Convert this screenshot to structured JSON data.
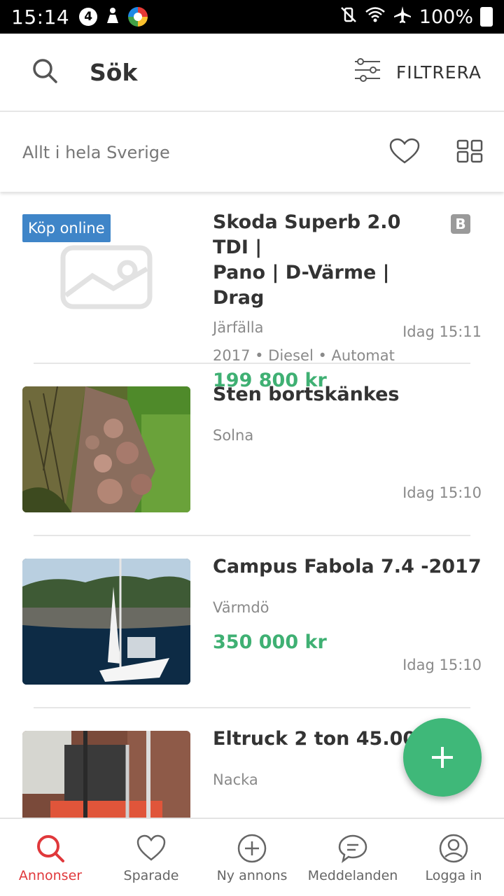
{
  "status_bar": {
    "time": "15:14",
    "battery": "100%",
    "badge_number": "4"
  },
  "header": {
    "title": "Sök",
    "filter_label": "FILTRERA"
  },
  "subbar": {
    "location": "Allt i hela Sverige"
  },
  "listings": [
    {
      "badge": "Köp online",
      "title_line1": "Skoda Superb 2.0 TDI |",
      "title_line2": "Pano | D-Värme | Drag",
      "seller_badge": "B",
      "location": "Järfälla",
      "meta": "2017 • Diesel • Automat",
      "price": "199 800 kr",
      "time": "Idag 15:11"
    },
    {
      "title_line1": "Sten bortskänkes",
      "location": "Solna",
      "time": "Idag 15:10"
    },
    {
      "title_line1": "Campus Fabola 7.4 -2017",
      "location": "Värmdö",
      "price": "350 000 kr",
      "time": "Idag 15:10"
    },
    {
      "title_line1": "Eltruck 2 ton 45.000",
      "location": "Nacka"
    }
  ],
  "bottom_nav": [
    {
      "label": "Annonser",
      "icon": "search-icon",
      "active": true
    },
    {
      "label": "Sparade",
      "icon": "heart-icon"
    },
    {
      "label": "Ny annons",
      "icon": "plus-circle-icon"
    },
    {
      "label": "Meddelanden",
      "icon": "chat-icon"
    },
    {
      "label": "Logga in",
      "icon": "user-icon"
    }
  ],
  "colors": {
    "accent_green": "#3fb073",
    "active_red": "#e0383b",
    "online_badge": "#3f85c8"
  }
}
